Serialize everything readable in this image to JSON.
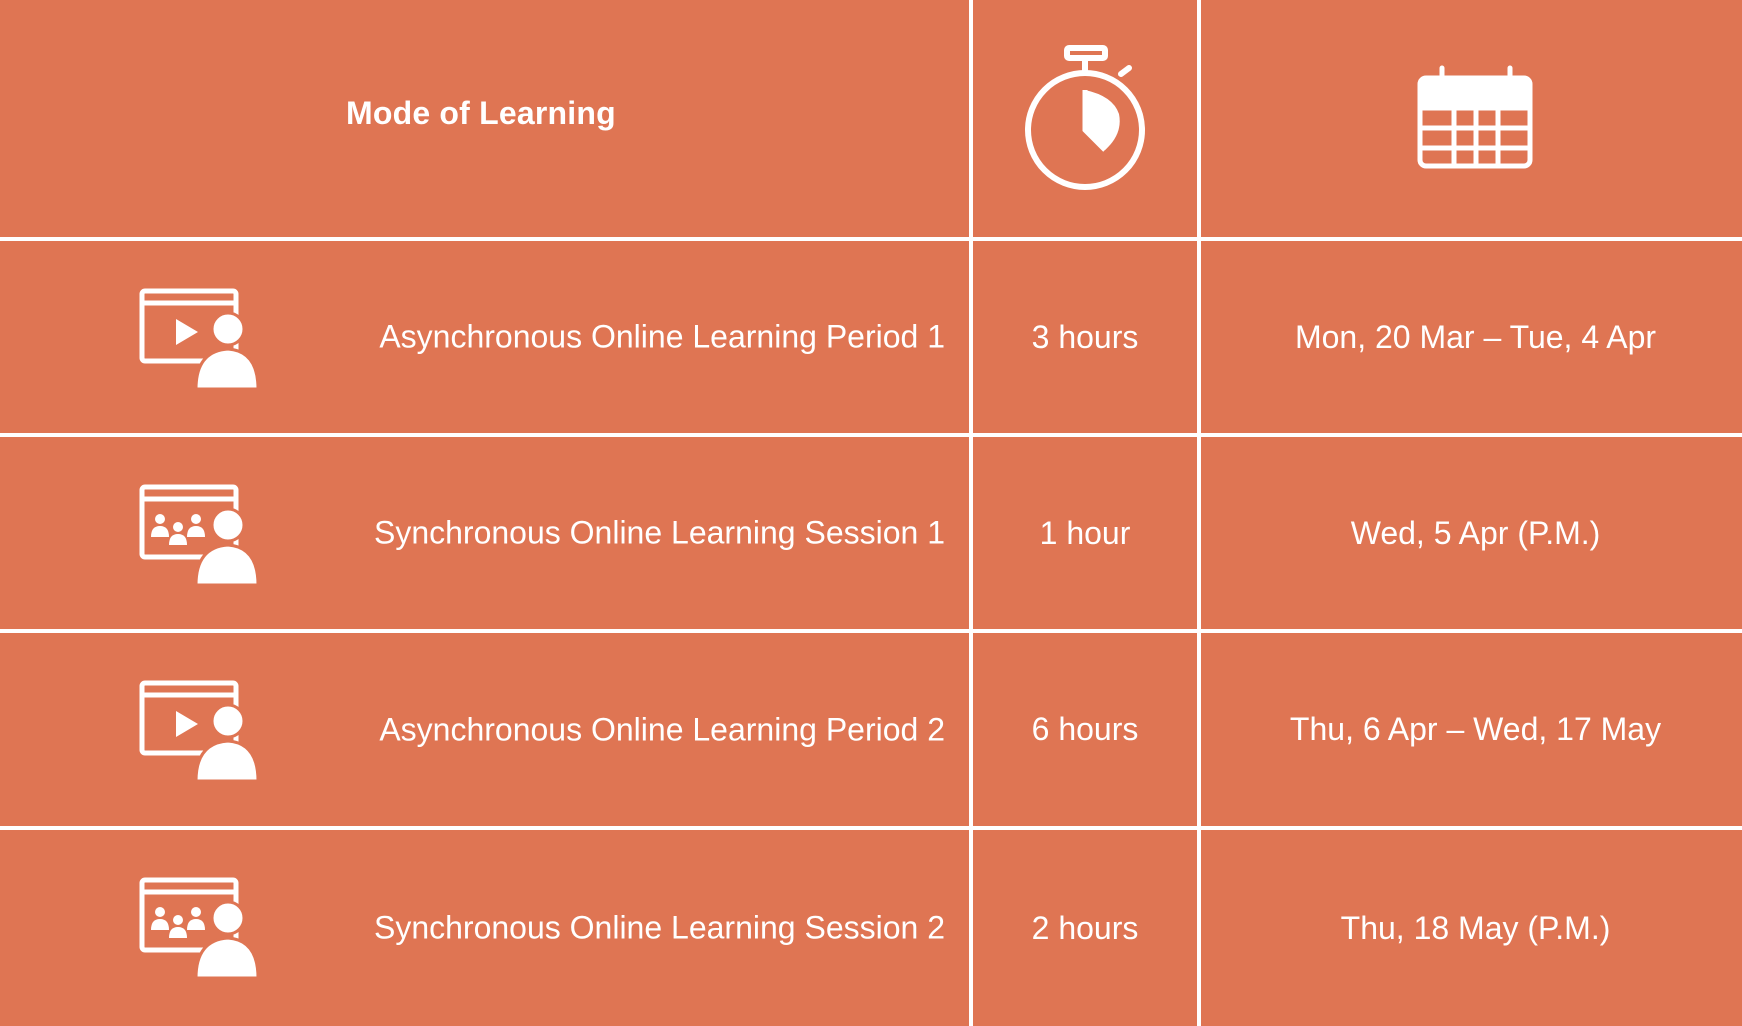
{
  "header": {
    "mode_title": "Mode of Learning",
    "duration_icon": "stopwatch-icon",
    "date_icon": "calendar-icon"
  },
  "colors": {
    "cell_background": "#df7553",
    "text": "#ffffff",
    "grid_lines": "#ffffff"
  },
  "rows": [
    {
      "icon": "asynchronous-video-learner-icon",
      "mode": "Asynchronous Online Learning Period 1",
      "duration": "3 hours",
      "dates": "Mon, 20 Mar – Tue, 4 Apr"
    },
    {
      "icon": "synchronous-group-learner-icon",
      "mode": "Synchronous Online Learning Session 1",
      "duration": "1 hour",
      "dates": "Wed, 5 Apr (P.M.)"
    },
    {
      "icon": "asynchronous-video-learner-icon",
      "mode": "Asynchronous Online Learning Period 2",
      "duration": "6 hours",
      "dates": "Thu, 6 Apr – Wed, 17 May"
    },
    {
      "icon": "synchronous-group-learner-icon",
      "mode": "Synchronous Online Learning Session 2",
      "duration": "2 hours",
      "dates": "Thu, 18 May (P.M.)"
    }
  ]
}
